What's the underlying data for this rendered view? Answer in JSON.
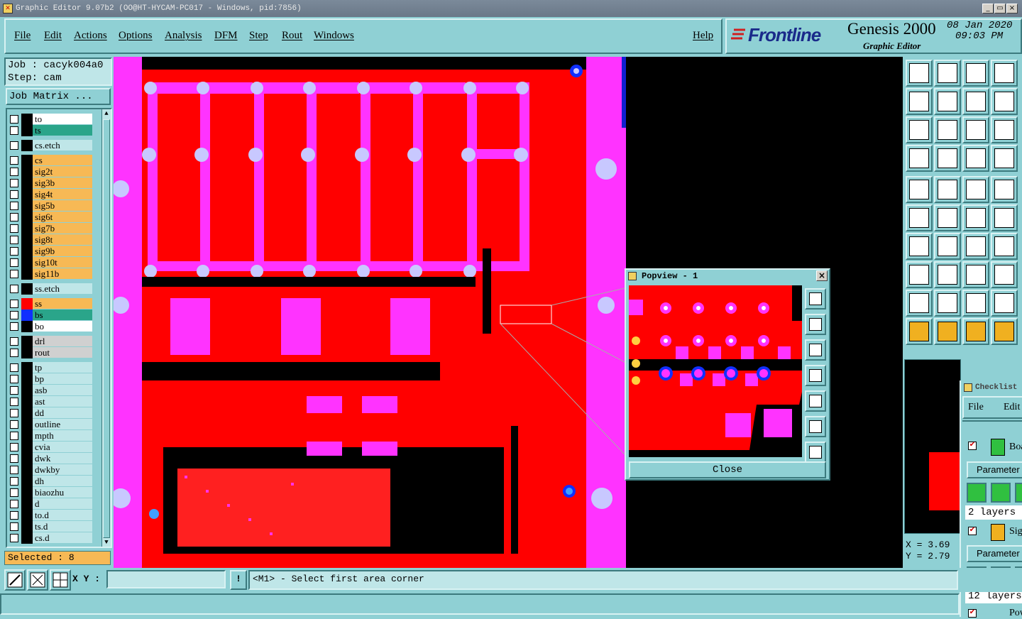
{
  "window": {
    "title": "Graphic Editor 9.07b2 (OO@HT-HYCAM-PC017 - Windows, pid:7856)",
    "btn_min": "_",
    "btn_max": "▭",
    "btn_close": "×"
  },
  "menu": {
    "file": "File",
    "edit": "Edit",
    "actions": "Actions",
    "options": "Options",
    "analysis": "Analysis",
    "dfm": "DFM",
    "step": "Step",
    "rout": "Rout",
    "windows": "Windows",
    "help": "Help"
  },
  "brand": {
    "logo": "Frontline",
    "product": "Genesis 2000",
    "subtitle": "Graphic Editor",
    "date": "08 Jan 2020",
    "time": "09:03 PM"
  },
  "job": {
    "job_line": "Job : cacyk004a0",
    "step_line": "Step: cam",
    "matrix_button": "Job Matrix ..."
  },
  "layers": [
    {
      "name": "to",
      "color": "#ffffff",
      "swatch": "#000000"
    },
    {
      "name": "ts",
      "color": "#2aa58a",
      "swatch": "#000000"
    },
    {
      "name": "cs.etch",
      "color": "#bfe6e8",
      "swatch": "#000000"
    },
    {
      "name": "cs",
      "color": "#f7b955",
      "swatch": "#000000"
    },
    {
      "name": "sig2t",
      "color": "#f7b955",
      "swatch": "#000000"
    },
    {
      "name": "sig3b",
      "color": "#f7b955",
      "swatch": "#000000"
    },
    {
      "name": "sig4t",
      "color": "#f7b955",
      "swatch": "#000000"
    },
    {
      "name": "sig5b",
      "color": "#f7b955",
      "swatch": "#000000"
    },
    {
      "name": "sig6t",
      "color": "#f7b955",
      "swatch": "#000000"
    },
    {
      "name": "sig7b",
      "color": "#f7b955",
      "swatch": "#000000"
    },
    {
      "name": "sig8t",
      "color": "#f7b955",
      "swatch": "#000000"
    },
    {
      "name": "sig9b",
      "color": "#f7b955",
      "swatch": "#000000"
    },
    {
      "name": "sig10t",
      "color": "#f7b955",
      "swatch": "#000000"
    },
    {
      "name": "sig11b",
      "color": "#f7b955",
      "swatch": "#000000"
    },
    {
      "name": "ss.etch",
      "color": "#bfe6e8",
      "swatch": "#000000"
    },
    {
      "name": "ss",
      "color": "#f7b955",
      "swatch": "#ff0000"
    },
    {
      "name": "bs",
      "color": "#2aa58a",
      "swatch": "#1030ff"
    },
    {
      "name": "bo",
      "color": "#ffffff",
      "swatch": "#000000"
    },
    {
      "name": "drl",
      "color": "#d0d0d0",
      "swatch": "#000000"
    },
    {
      "name": "rout",
      "color": "#d0d0d0",
      "swatch": "#000000"
    },
    {
      "name": "tp",
      "color": "#bfe6e8",
      "swatch": "#000000"
    },
    {
      "name": "bp",
      "color": "#bfe6e8",
      "swatch": "#000000"
    },
    {
      "name": "asb",
      "color": "#bfe6e8",
      "swatch": "#000000"
    },
    {
      "name": "ast",
      "color": "#bfe6e8",
      "swatch": "#000000"
    },
    {
      "name": "dd",
      "color": "#bfe6e8",
      "swatch": "#000000"
    },
    {
      "name": "outline",
      "color": "#bfe6e8",
      "swatch": "#000000"
    },
    {
      "name": "mpth",
      "color": "#bfe6e8",
      "swatch": "#000000"
    },
    {
      "name": "cvia",
      "color": "#bfe6e8",
      "swatch": "#000000"
    },
    {
      "name": "dwk",
      "color": "#bfe6e8",
      "swatch": "#000000"
    },
    {
      "name": "dwkby",
      "color": "#bfe6e8",
      "swatch": "#000000"
    },
    {
      "name": "dh",
      "color": "#bfe6e8",
      "swatch": "#000000"
    },
    {
      "name": "biaozhu",
      "color": "#bfe6e8",
      "swatch": "#000000"
    },
    {
      "name": "d",
      "color": "#bfe6e8",
      "swatch": "#000000"
    },
    {
      "name": "to.d",
      "color": "#bfe6e8",
      "swatch": "#000000"
    },
    {
      "name": "ts.d",
      "color": "#bfe6e8",
      "swatch": "#000000"
    },
    {
      "name": "cs.d",
      "color": "#bfe6e8",
      "swatch": "#000000"
    }
  ],
  "selected": "Selected : 8",
  "command": {
    "xy_label": "X Y :",
    "xy_value": "",
    "prompt": "<M1> - Select first area corner"
  },
  "coords": {
    "x": "X = 3.69",
    "y": "Y = 2.79"
  },
  "popview": {
    "title": "Popview - 1",
    "close": "Close"
  },
  "checklist": {
    "title": "Checklist",
    "file": "File",
    "edit": "Edit",
    "item1": "Boa",
    "param1": "Parameter",
    "layers1": "2 layers",
    "item2": "Sig",
    "param2": "Parameter",
    "layers2": "12 layers",
    "item3": "Pow"
  }
}
